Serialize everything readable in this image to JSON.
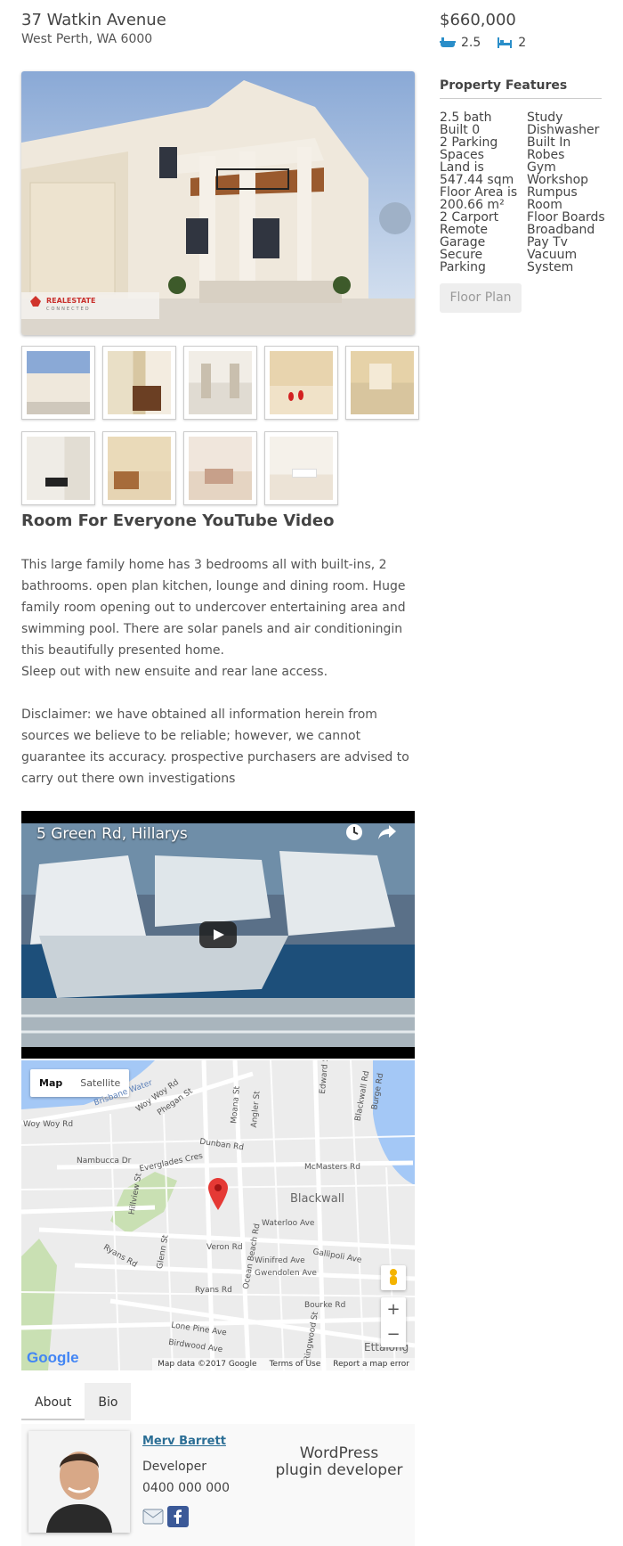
{
  "listing": {
    "address": "37 Watkin Avenue",
    "suburb": "West Perth, WA 6000",
    "price": "$660,000",
    "baths": "2.5",
    "beds": "2"
  },
  "features": {
    "title": "Property Features",
    "col1": [
      "2.5 bath",
      "Built 0",
      "2 Parking",
      "Spaces",
      "Land is",
      "547.44 sqm",
      "Floor Area is",
      "200.66 m²",
      "2 Carport",
      "Remote",
      "Garage",
      "Secure",
      "Parking"
    ],
    "col2": [
      "Study",
      "Dishwasher",
      "Built In",
      "Robes",
      "Gym",
      "Workshop",
      "Rumpus",
      "Room",
      "Floor Boards",
      "Broadband",
      "Pay Tv",
      "Vacuum",
      "System"
    ],
    "floor_plan_label": "Floor Plan"
  },
  "hero": {
    "watermark_brand": "REALESTATE",
    "watermark_sub": "CONNECTED"
  },
  "content": {
    "heading": "Room For Everyone YouTube Video",
    "paragraph1": "This large family home has 3 bedrooms all with built-ins, 2 bathrooms. open plan kitchen, lounge and dining room. Huge family room opening out to undercover entertaining area and swimming pool. There are solar panels and air conditioningin this beautifully presented home.\nSleep out with new ensuite and rear lane access.",
    "paragraph2": "Disclaimer: we have obtained all information herein from sources we believe to be reliable; however, we cannot guarantee its accuracy. prospective purchasers are advised to carry out there own investigations"
  },
  "video": {
    "title": "5 Green Rd, Hillarys"
  },
  "map": {
    "map_label": "Map",
    "satellite_label": "Satellite",
    "footer_data": "Map data ©2017 Google",
    "footer_terms": "Terms of Use",
    "footer_report": "Report a map error",
    "google_logo": "Google",
    "suburb": "Blackwall",
    "corner_town": "Ettalong",
    "roads": [
      "Brisbane Water",
      "Woy Woy Rd",
      "Phegan St",
      "Woy Woy Rd",
      "Moana St",
      "Angler St",
      "Edward St",
      "Blackwall Rd",
      "Burge Rd",
      "Dunban Rd",
      "Nambucca Dr",
      "Everglades Cres",
      "McMasters Rd",
      "Hillview St",
      "Ocean Beach Rd",
      "Waterloo Ave",
      "Veron Rd",
      "Winifred Ave",
      "Gallipoli Ave",
      "Gwendolen Ave",
      "Ryans Rd",
      "Glenn St",
      "Ryans Rd",
      "Bourke Rd",
      "Lone Pine Ave",
      "Ringwood St",
      "Birdwood Ave"
    ],
    "zoom_in": "+",
    "zoom_out": "−"
  },
  "agent": {
    "tab_about": "About",
    "tab_bio": "Bio",
    "name": "Merv Barrett",
    "role": "Developer",
    "phone": "0400 000 000",
    "bio": "WordPress plugin developer"
  },
  "colors": {
    "accent_link": "#2b6e95",
    "bed_bath_icon": "#2a8ec9",
    "map_pin": "#e53935"
  },
  "icons": [
    "bath-icon",
    "bed-icon",
    "clock-icon",
    "share-icon",
    "play-icon",
    "map-pin-icon",
    "pegman-icon",
    "email-icon",
    "facebook-icon"
  ]
}
